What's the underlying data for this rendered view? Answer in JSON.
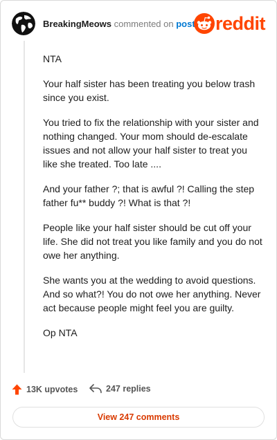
{
  "header": {
    "username": "BreakingMeows",
    "action_text": "commented on",
    "post_link": "post",
    "logo_text": "reddit"
  },
  "comment": {
    "paragraphs": [
      "NTA",
      "Your half sister has been treating you below trash since you exist.",
      "You tried to fix the relationship with your sister and nothing changed. Your mom should de-escalate issues and not allow your half sister to treat you like she treated. Too late ....",
      "And your father ?; that is awful ?! Calling the step father fu** buddy ?! What is that ?!",
      "People like your half sister should be cut off your life. She did not treat you like family and you do not owe her anything.",
      "She wants you at the wedding to avoid questions. And so what?! You do not owe her anything. Never act because people might feel you are guilty.",
      "Op NTA"
    ]
  },
  "footer": {
    "upvotes": "13K upvotes",
    "replies": "247 replies",
    "view_comments": "View 247 comments"
  },
  "colors": {
    "brand": "#ff4500",
    "link": "#0079d3",
    "upvote": "#ff4500",
    "view_button_text": "#d93a00"
  },
  "icons": {
    "avatar": "globe-avatar-icon",
    "logo": "reddit-snoo-icon",
    "upvote": "upvote-arrow-icon",
    "reply": "reply-arrow-icon"
  }
}
